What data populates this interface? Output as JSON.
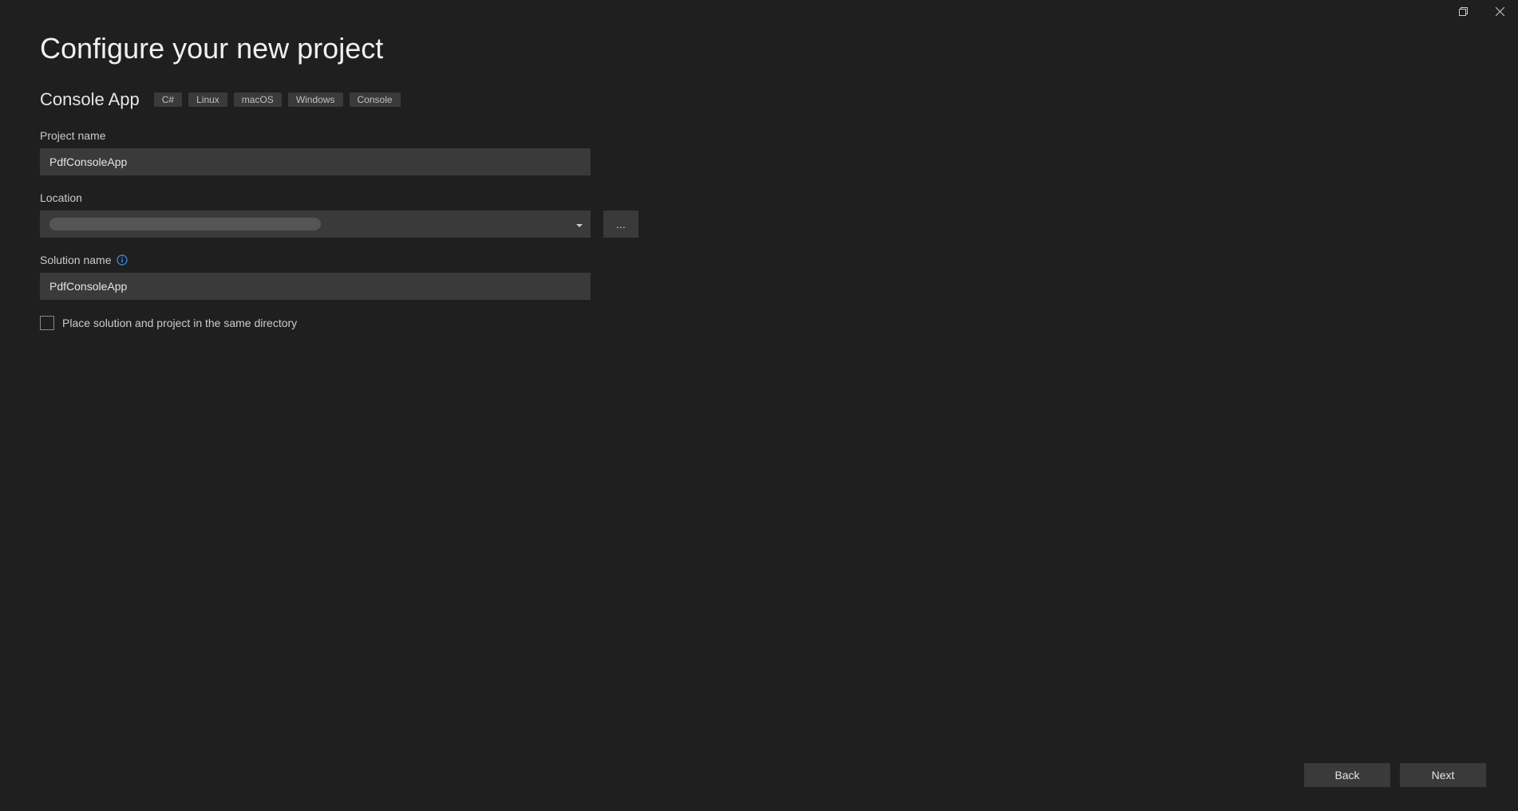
{
  "window": {
    "title": "Configure your new project"
  },
  "header": {
    "app_type": "Console App",
    "tags": [
      "C#",
      "Linux",
      "macOS",
      "Windows",
      "Console"
    ]
  },
  "form": {
    "project_name": {
      "label": "Project name",
      "value": "PdfConsoleApp"
    },
    "location": {
      "label": "Location",
      "value": "",
      "browse_label": "..."
    },
    "solution_name": {
      "label": "Solution name",
      "value": "PdfConsoleApp"
    },
    "place_same_dir": {
      "label": "Place solution and project in the same directory",
      "checked": false
    }
  },
  "footer": {
    "back_label": "Back",
    "next_label": "Next"
  }
}
